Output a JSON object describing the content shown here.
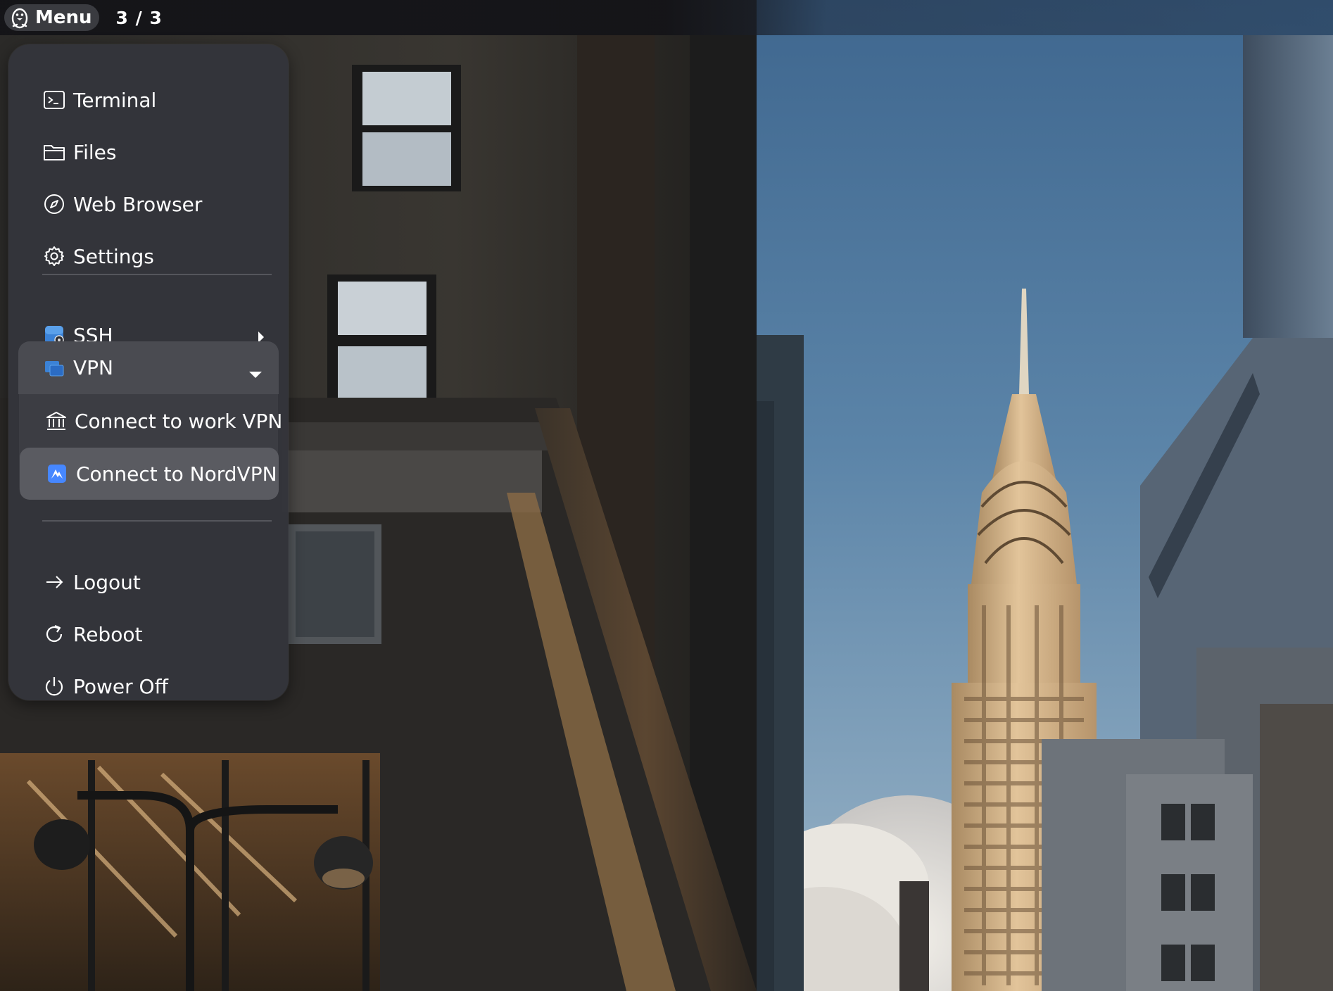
{
  "panel": {
    "menu_label": "Menu",
    "workspace": "3 / 3"
  },
  "menu": {
    "apps": [
      {
        "label": "Terminal",
        "icon": "terminal-icon"
      },
      {
        "label": "Files",
        "icon": "folder-icon"
      },
      {
        "label": "Web Browser",
        "icon": "compass-icon"
      },
      {
        "label": "Settings",
        "icon": "gear-icon"
      }
    ],
    "ssh": {
      "label": "SSH",
      "icon": "ssh-icon",
      "expanded": false
    },
    "vpn": {
      "label": "VPN",
      "icon": "vpn-icon",
      "expanded": true,
      "items": [
        {
          "label": "Connect to work VPN",
          "icon": "building-icon"
        },
        {
          "label": "Connect to NordVPN",
          "icon": "nordvpn-icon",
          "highlighted": true
        }
      ]
    },
    "session": [
      {
        "label": "Logout",
        "icon": "arrow-right-icon"
      },
      {
        "label": "Reboot",
        "icon": "reboot-icon"
      },
      {
        "label": "Power Off",
        "icon": "power-icon"
      }
    ]
  },
  "colors": {
    "menu_background": "#34353b",
    "highlight": "#5a5b61",
    "panel": "#141418",
    "text": "#ffffff"
  }
}
